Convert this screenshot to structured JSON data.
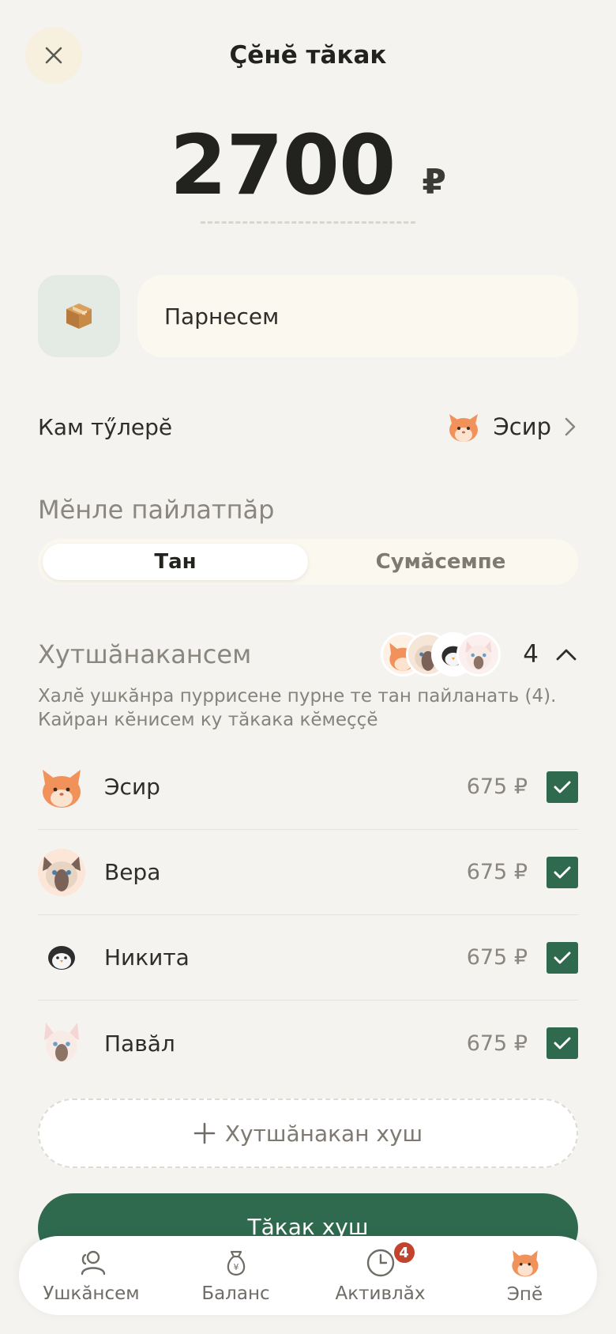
{
  "header": {
    "title": "Ҫӗнӗ тӑкак"
  },
  "amount": {
    "value": "2700",
    "currency": "₽"
  },
  "description": {
    "value": "Парнесем"
  },
  "payer": {
    "label": "Кам тӳлерӗ",
    "name": "Эсир"
  },
  "split": {
    "label": "Мӗнле пайлатпӑр",
    "options": [
      "Тан",
      "Сумӑсемпе"
    ],
    "selected": "Тан"
  },
  "participants": {
    "title": "Хутшӑнакансем",
    "count": "4",
    "hint": "Халӗ ушкӑнра пуррисене пурне те тан пайланать (4). Кайран кӗнисем ку тӑкака кӗмеҫҫӗ",
    "items": [
      {
        "name": "Эсир",
        "amount": "675 ₽",
        "avatar": "orange-cat-icon",
        "checked": true
      },
      {
        "name": "Вера",
        "amount": "675 ₽",
        "avatar": "siamese-cat-icon",
        "checked": true
      },
      {
        "name": "Никита",
        "amount": "675 ₽",
        "avatar": "penguin-icon",
        "checked": true
      },
      {
        "name": "Павӑл",
        "amount": "675 ₽",
        "avatar": "white-cat-icon",
        "checked": true
      }
    ],
    "add_label": "Хутшӑнакан хуш"
  },
  "submit": {
    "label": "Тӑкак хуш"
  },
  "tabbar": {
    "items": [
      {
        "label": "Ушкӑнсем",
        "icon": "people-icon"
      },
      {
        "label": "Баланс",
        "icon": "money-bag-icon"
      },
      {
        "label": "Активлӑх",
        "icon": "clock-icon",
        "badge": "4"
      },
      {
        "label": "Эпӗ",
        "icon": "orange-cat-icon"
      }
    ]
  },
  "colors": {
    "accent": "#2f6a4f",
    "badge": "#c4432d",
    "background": "#f5f3ef"
  }
}
